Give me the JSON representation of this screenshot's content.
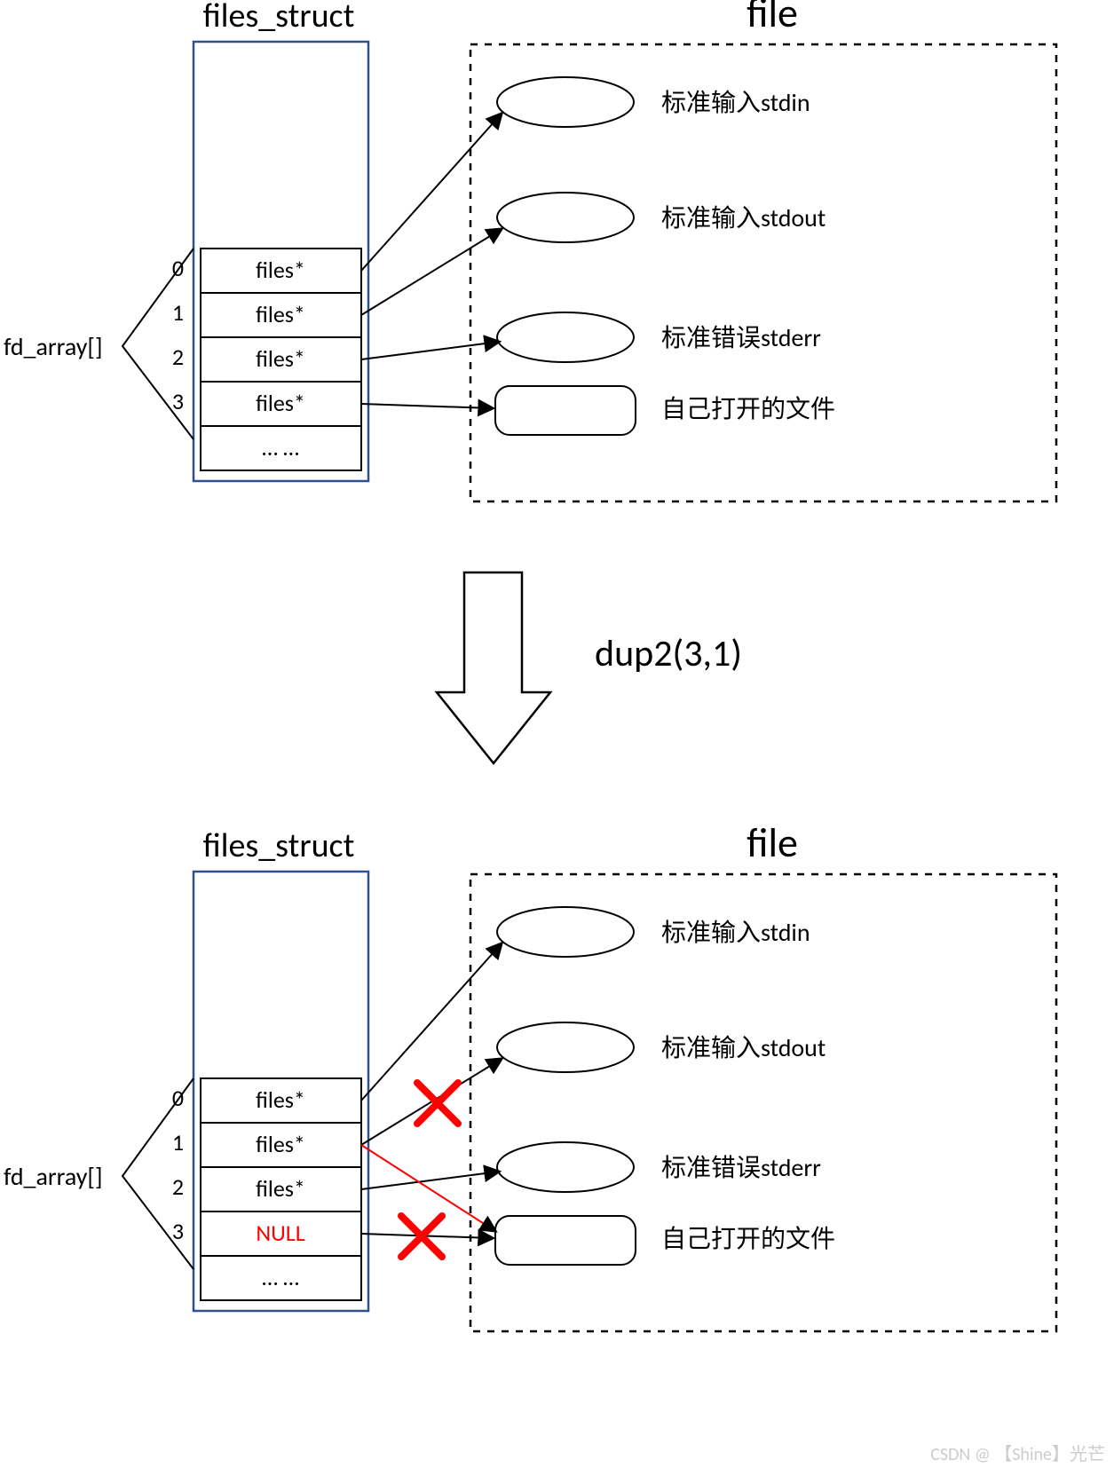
{
  "top": {
    "files_struct_title": "files_struct",
    "file_title": "file",
    "fd_array_label": "fd_array[]",
    "rows": [
      {
        "index": "0",
        "value": "files*"
      },
      {
        "index": "1",
        "value": "files*"
      },
      {
        "index": "2",
        "value": "files*"
      },
      {
        "index": "3",
        "value": "files*"
      },
      {
        "index": "",
        "value": "… …"
      }
    ],
    "files": [
      {
        "label": "标准输入stdin"
      },
      {
        "label": "标准输入stdout"
      },
      {
        "label": "标准错误stderr"
      },
      {
        "label": "自己打开的文件"
      }
    ]
  },
  "action": "dup2(3,1)",
  "bottom": {
    "files_struct_title": "files_struct",
    "file_title": "file",
    "fd_array_label": "fd_array[]",
    "rows": [
      {
        "index": "0",
        "value": "files*"
      },
      {
        "index": "1",
        "value": "files*"
      },
      {
        "index": "2",
        "value": "files*"
      },
      {
        "index": "3",
        "value": "NULL",
        "color": "#ff0000"
      },
      {
        "index": "",
        "value": "… …"
      }
    ],
    "files": [
      {
        "label": "标准输入stdin"
      },
      {
        "label": "标准输入stdout"
      },
      {
        "label": "标准错误stderr"
      },
      {
        "label": "自己打开的文件"
      }
    ]
  },
  "watermark": "CSDN @ 【Shine】光芒"
}
